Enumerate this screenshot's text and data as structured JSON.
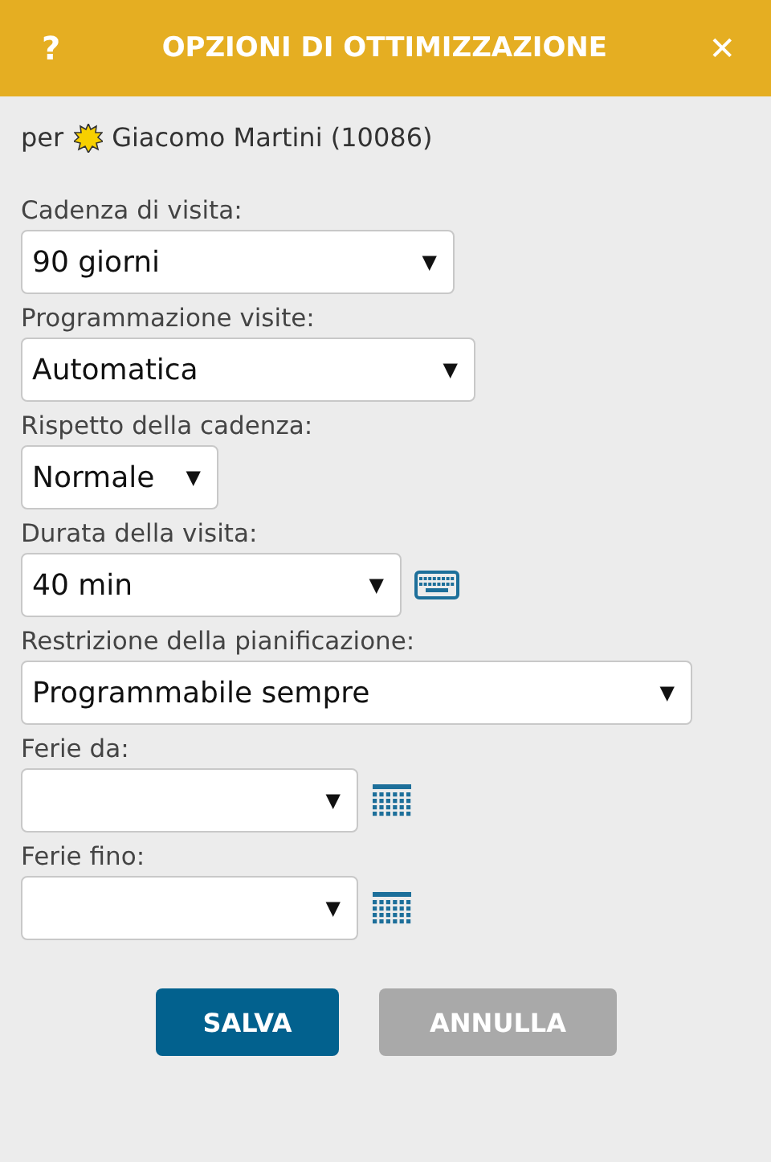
{
  "window": {
    "help": "?",
    "title": "OPZIONI DI OTTIMIZZAZIONE",
    "close": "✕"
  },
  "subject": {
    "prefix": "per",
    "name": "Giacomo Martini (10086)"
  },
  "fields": [
    {
      "kind": "plain",
      "label": "Cadenza di visita:",
      "value": "90 giorni",
      "caret": "▼"
    },
    {
      "kind": "plain",
      "label": "Programmazione visite:",
      "value": "Automatica",
      "caret": "▼"
    },
    {
      "kind": "plain",
      "label": "Rispetto della cadenza:",
      "value": "Normale",
      "caret": "▼"
    },
    {
      "kind": "keyboard",
      "label": "Durata della visita:",
      "value": "40 min",
      "caret": "▼"
    },
    {
      "kind": "plain",
      "label": "Restrizione della pianificazione:",
      "value": "Programmabile sempre",
      "caret": "▼"
    },
    {
      "kind": "calendar",
      "label": "Ferie da:",
      "caret": "▼"
    },
    {
      "kind": "calendar",
      "label": "Ferie fino:",
      "caret": "▼"
    }
  ],
  "buttons": [
    {
      "label": "SALVA",
      "disabled": false
    },
    {
      "label": "ANNULLA",
      "disabled": true
    }
  ]
}
